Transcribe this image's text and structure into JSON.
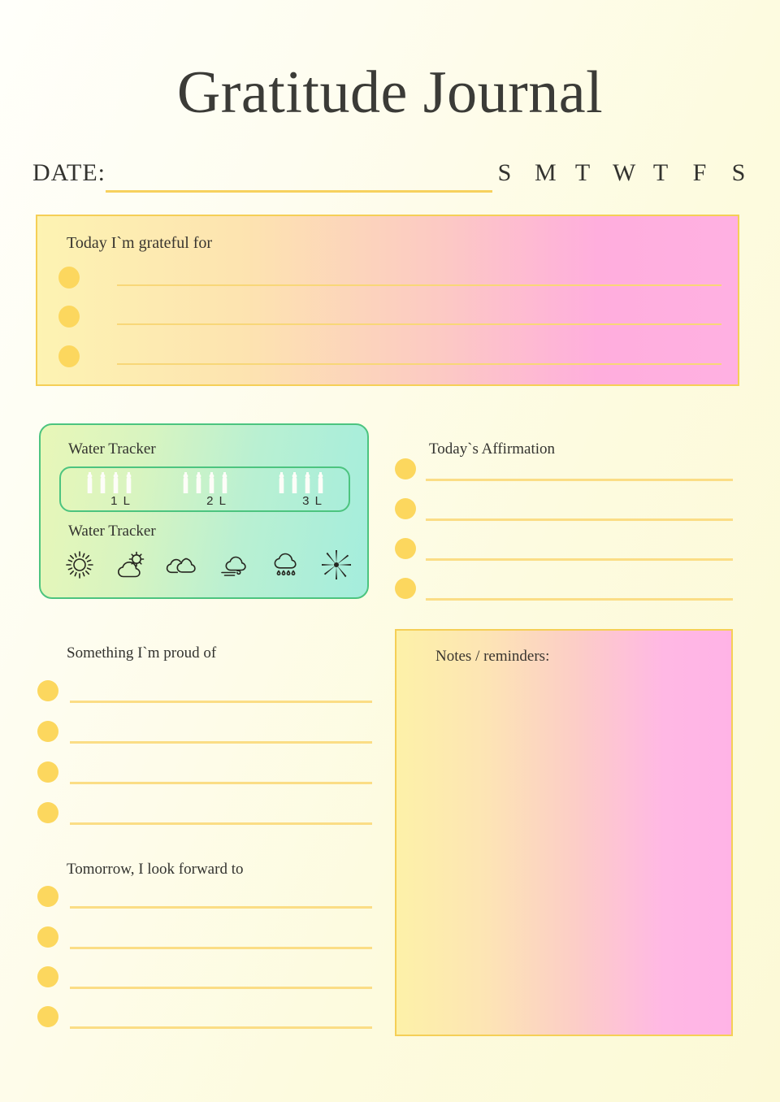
{
  "page": {
    "title": "Gratitude Journal",
    "background_start": "#fffffa",
    "background_end": "#fcf9d6",
    "accent_yellow": "#fcd75e",
    "line_yellow": "#fbdd85",
    "border_gold": "#f5cf56",
    "border_green": "#4cc47f"
  },
  "date": {
    "label": "DATE:",
    "value": "",
    "days": [
      "S",
      "M",
      "T",
      "W",
      "T",
      "F",
      "S"
    ]
  },
  "gratitude": {
    "heading": "Today I`m grateful for",
    "entries": [
      "",
      "",
      ""
    ]
  },
  "water_tracker": {
    "heading": "Water Tracker",
    "groups": [
      {
        "label": "1 L",
        "bottles": 4
      },
      {
        "label": "2 L",
        "bottles": 4
      },
      {
        "label": "3 L",
        "bottles": 4
      }
    ]
  },
  "weather_tracker": {
    "heading": "Water Tracker",
    "icons": [
      "sun-icon",
      "partly-cloudy-icon",
      "cloudy-icon",
      "windy-icon",
      "rainy-icon",
      "snowflake-icon"
    ]
  },
  "affirmation": {
    "heading": "Today`s Affirmation",
    "entries": [
      "",
      "",
      "",
      ""
    ]
  },
  "proud_of": {
    "heading": "Something I`m proud of",
    "entries": [
      "",
      "",
      "",
      ""
    ]
  },
  "tomorrow": {
    "heading": "Tomorrow, I look forward to",
    "entries": [
      "",
      "",
      "",
      ""
    ]
  },
  "notes": {
    "heading": "Notes / reminders:",
    "value": ""
  }
}
